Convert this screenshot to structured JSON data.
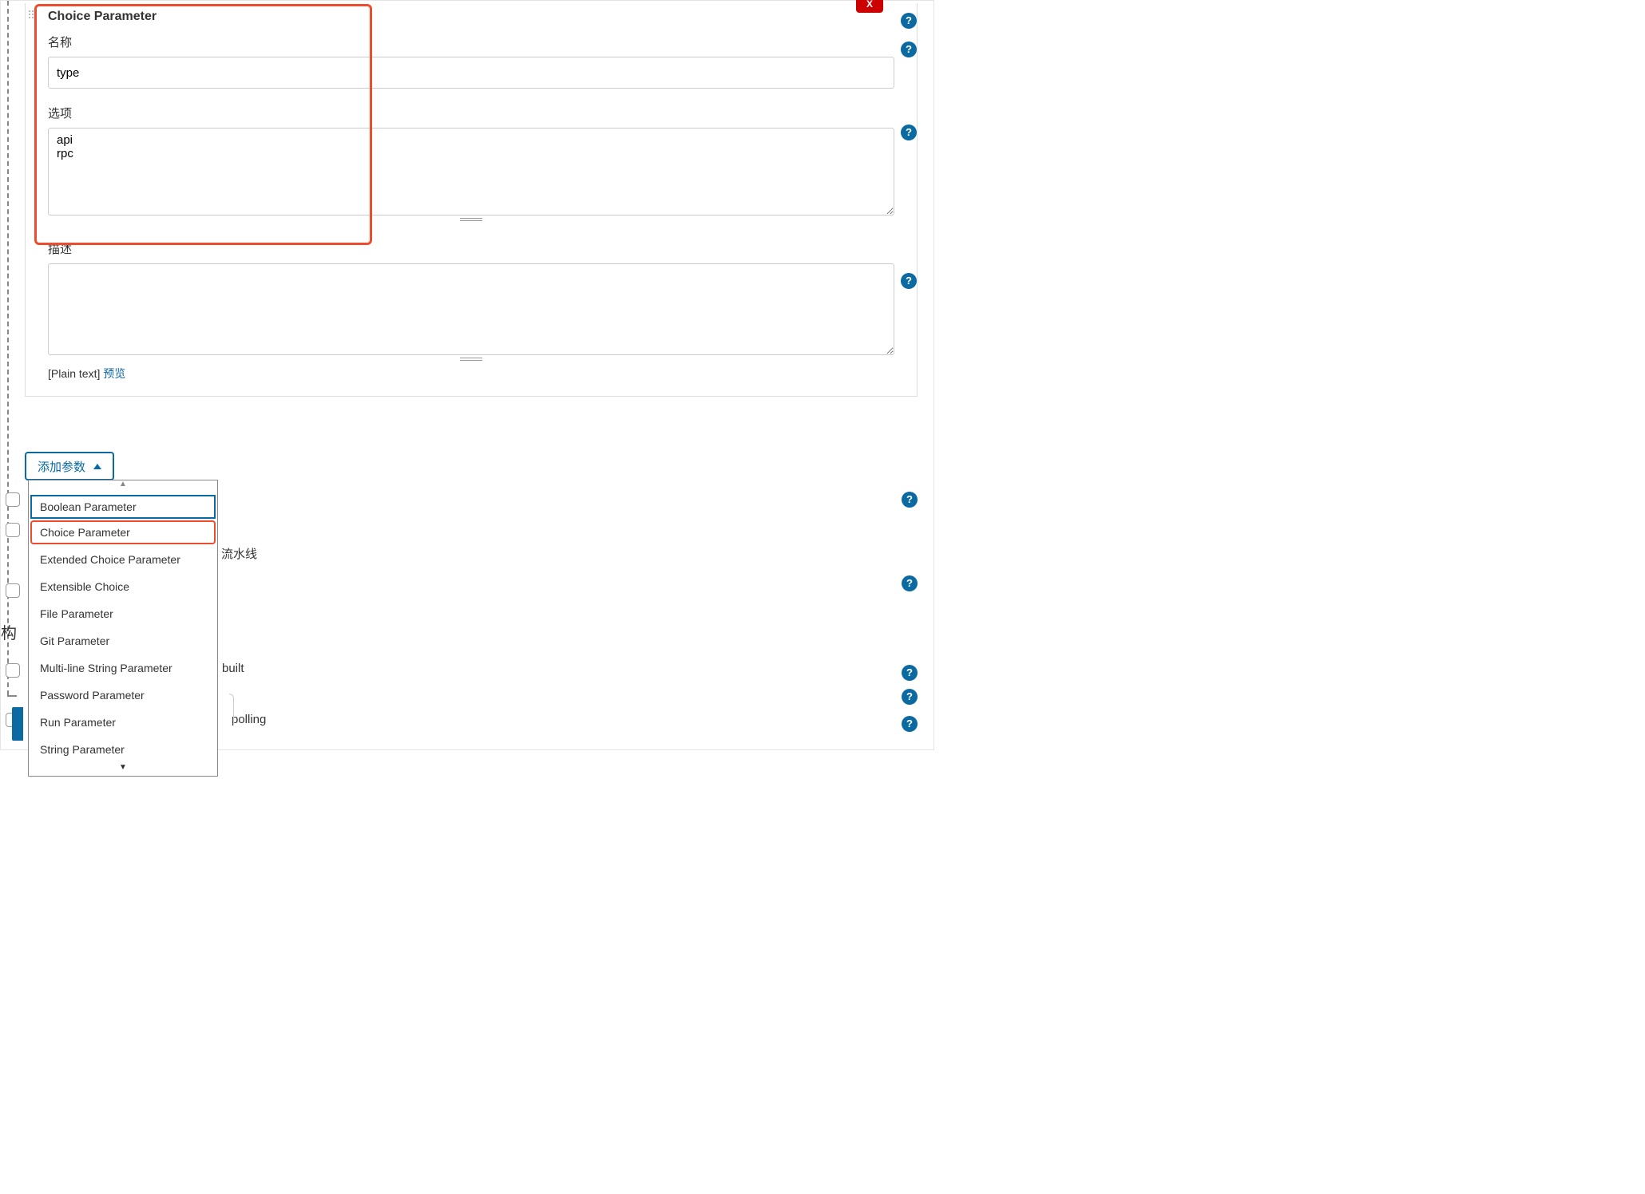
{
  "panel": {
    "title": "Choice Parameter",
    "name_label": "名称",
    "name_value": "type",
    "choices_label": "选项",
    "choices_value": "api\nrpc",
    "description_label": "描述",
    "description_value": "",
    "plain_text_label": "[Plain text]",
    "preview_link": "预览",
    "delete_symbol": "X"
  },
  "help_symbol": "?",
  "add_param_button": "添加参数",
  "dropdown_items": [
    "Boolean Parameter",
    "Choice Parameter",
    "Extended Choice Parameter",
    "Extensible Choice",
    "File Parameter",
    "Git Parameter",
    "Multi-line String Parameter",
    "Password Parameter",
    "Run Parameter",
    "String Parameter"
  ],
  "scroll_arrow_up": "▲",
  "scroll_arrow_down": "▼",
  "background": {
    "pipeline_fragment": "流水线",
    "build_header_fragment": "构",
    "built_fragment": "built",
    "polling_fragment": "polling"
  }
}
